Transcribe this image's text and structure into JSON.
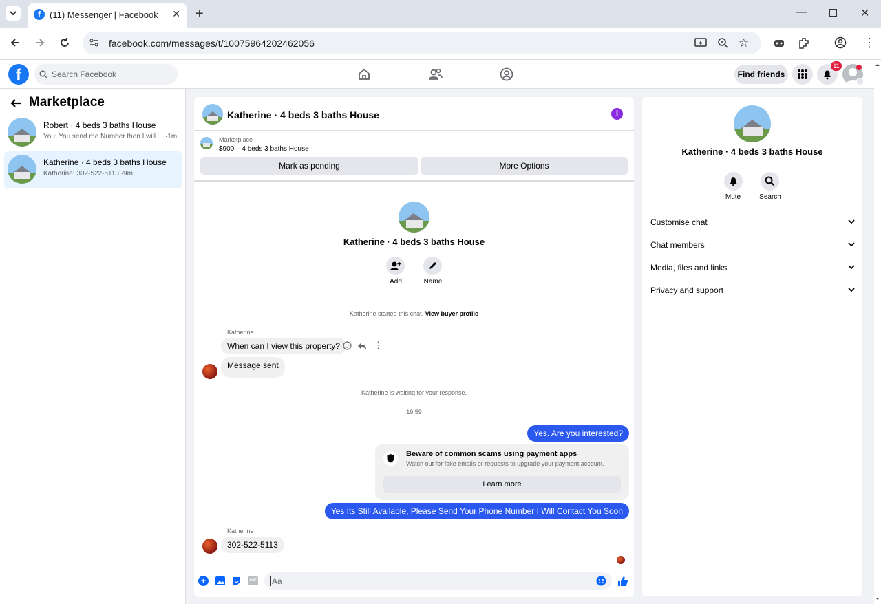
{
  "browser": {
    "tab_title": "(11) Messenger | Facebook",
    "url": "facebook.com/messages/t/10075964202462056"
  },
  "header": {
    "search_placeholder": "Search Facebook",
    "find_friends": "Find friends",
    "notification_count": "11"
  },
  "sidebar": {
    "title": "Marketplace",
    "conversations": [
      {
        "name": "Robert · 4 beds 3 baths House",
        "preview": "You: You send me Number then I will ... ·1m"
      },
      {
        "name": "Katherine · 4 beds 3 baths House",
        "preview": "Katherine: 302-522-5113 ·9m"
      }
    ]
  },
  "chat": {
    "title": "Katherine · 4 beds 3 baths House",
    "listing_label": "Marketplace",
    "listing_price": "$900 – 4 beds 3 baths House",
    "mark_pending": "Mark as pending",
    "more_options": "More Options",
    "profile_name": "Katherine · 4 beds 3 baths House",
    "add_label": "Add",
    "name_label": "Name",
    "started_text": "Katherine started this chat.",
    "view_buyer": "View buyer profile",
    "sender1": "Katherine",
    "msg1": "When can I view this property?",
    "msg_sent": "Message sent",
    "waiting": "Katherine is waiting for your response.",
    "time": "19:59",
    "out1": "Yes. Are you interested?",
    "scam_title": "Beware of common scams using payment apps",
    "scam_desc": "Watch out for fake emails or requests to upgrade your payment account.",
    "learn_more": "Learn more",
    "out2": "Yes Its Still Available, Please Send Your Phone Number I Will Contact You Soon",
    "sender2": "Katherine",
    "msg2": "302-522-5113",
    "composer_placeholder": "Aa",
    "gif_label": "GIF"
  },
  "info_panel": {
    "name": "Katherine · 4 beds 3 baths House",
    "mute": "Mute",
    "search": "Search",
    "sections": [
      "Customise chat",
      "Chat members",
      "Media, files and links",
      "Privacy and support"
    ]
  },
  "colors": {
    "fb_blue": "#1877f2",
    "outgoing_bubble": "#2b58ef",
    "info_purple": "#8a2be2"
  }
}
